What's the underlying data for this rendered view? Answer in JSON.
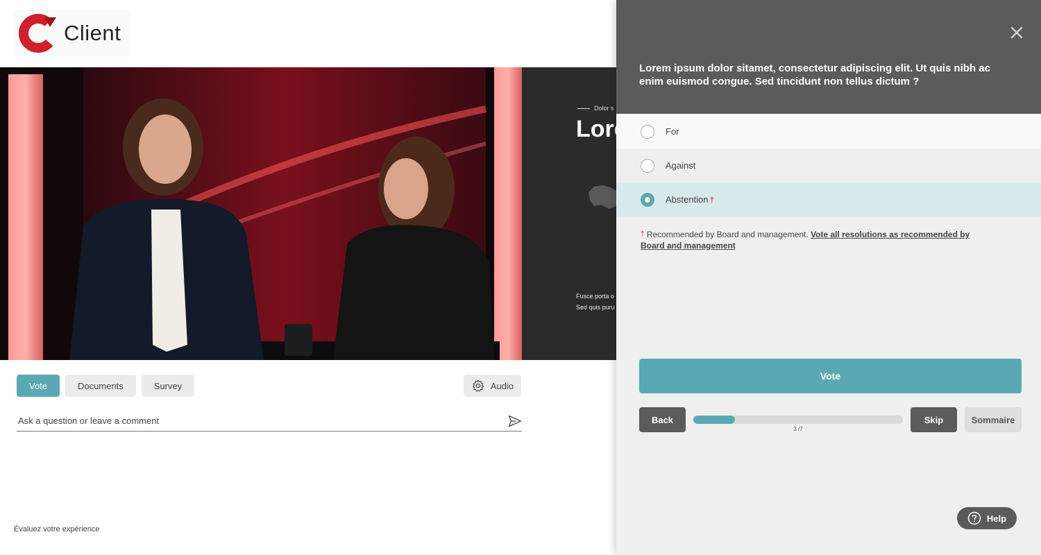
{
  "brand": {
    "name": "Client",
    "logo_icon": "c-logo-icon",
    "accent": "#d0202a"
  },
  "slide": {
    "kicker": "Dolor s",
    "title": "Lore",
    "body_line1": "Fusce porta o",
    "body_line2": "Sed quis puru"
  },
  "tabs": [
    {
      "label": "Vote",
      "active": true
    },
    {
      "label": "Documents",
      "active": false
    },
    {
      "label": "Survey",
      "active": false
    }
  ],
  "audio": {
    "label": "Audio",
    "icon": "gear-icon"
  },
  "comment": {
    "placeholder": "Ask a question or leave a comment",
    "icon": "send-icon"
  },
  "rate_link": "Évaluez votre expérience",
  "panel": {
    "question": "Lorem ipsum dolor sitamet, consectetur adipiscing elit. Ut quis nibh ac enim euismod congue. Sed tincidunt non tellus dictum ?",
    "options": [
      {
        "label": "For",
        "selected": false
      },
      {
        "label": "Against",
        "selected": false
      },
      {
        "label": "Abstention",
        "selected": true,
        "marker": "†"
      }
    ],
    "recommendation": {
      "marker": "†",
      "text": "Recommended by Board and management.",
      "link": "Vote all resolutions as recommended by Board and management"
    },
    "vote_label": "Vote",
    "back_label": "Back",
    "skip_label": "Skip",
    "summary_label": "Sommaire",
    "progress": {
      "current": 3,
      "total": 7,
      "label": "3 /7",
      "fraction": 0.2
    },
    "help_label": "Help",
    "colors": {
      "header": "#5b5b5b",
      "accent": "#5aa8b3",
      "selected_row": "#d8e9ec"
    }
  }
}
